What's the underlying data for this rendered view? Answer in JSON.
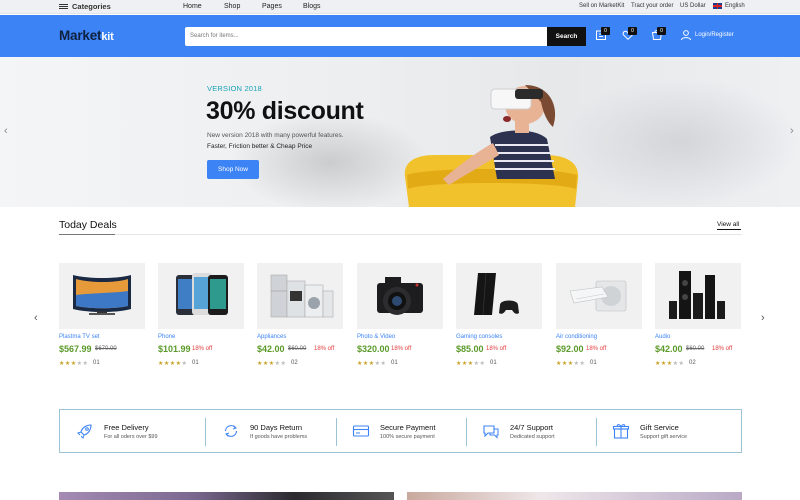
{
  "topbar": {
    "categories": "Categories",
    "nav": [
      "Home",
      "Shop",
      "Pages",
      "Blogs"
    ],
    "sell": "Sell on MarketKit",
    "track": "Tract your order",
    "currency": "US Dollar",
    "language": "English"
  },
  "header": {
    "logo_main": "Market",
    "logo_accent": "kit",
    "search_placeholder": "Search for items...",
    "search_button": "Search",
    "compare_count": "0",
    "wishlist_count": "0",
    "cart_count": "0",
    "login": "Login/Register"
  },
  "hero": {
    "version": "VERSION 2018",
    "headline": "30% discount",
    "line1": "New version 2018 with many powerful features.",
    "line2": "Faster, Friction better & Cheap Price",
    "cta": "Shop Now"
  },
  "deals": {
    "title": "Today Deals",
    "view_all": "View all",
    "products": [
      {
        "name": "Plastma TV set",
        "price": "$567.99",
        "old": "$670.00",
        "off": "",
        "stars": 3,
        "reviews": "01",
        "icon": "tv-icon"
      },
      {
        "name": "Phone",
        "price": "$101.99",
        "old": "",
        "off": "18% off",
        "stars": 4,
        "reviews": "01",
        "icon": "phone-icon"
      },
      {
        "name": "Appliances",
        "price": "$42.00",
        "old": "$60.00",
        "off": "18% off",
        "stars": 3,
        "reviews": "02",
        "icon": "appliances-icon"
      },
      {
        "name": "Photo & Video",
        "price": "$320.00",
        "old": "",
        "off": "18% off",
        "stars": 3,
        "reviews": "01",
        "icon": "camera-icon"
      },
      {
        "name": "Gaming consoles",
        "price": "$85.00",
        "old": "",
        "off": "18% off",
        "stars": 3,
        "reviews": "01",
        "icon": "console-icon"
      },
      {
        "name": "Air conditioning",
        "price": "$92.00",
        "old": "",
        "off": "18% off",
        "stars": 3,
        "reviews": "01",
        "icon": "air-conditioner-icon"
      },
      {
        "name": "Audio",
        "price": "$42.00",
        "old": "$60.00",
        "off": "18% off",
        "stars": 3,
        "reviews": "02",
        "icon": "speakers-icon"
      }
    ]
  },
  "services": [
    {
      "title": "Free Delivery",
      "desc": "For all oders over $99",
      "icon": "rocket-icon"
    },
    {
      "title": "90 Days Return",
      "desc": "If goods have problems",
      "icon": "return-icon"
    },
    {
      "title": "Secure Payment",
      "desc": "100% secure payment",
      "icon": "credit-card-icon"
    },
    {
      "title": "24/7 Support",
      "desc": "Dedicated support",
      "icon": "support-chat-icon"
    },
    {
      "title": "Gift Service",
      "desc": "Support gift service",
      "icon": "gift-icon"
    }
  ],
  "colors": {
    "brand_blue": "#3c83f6",
    "price_green": "#5b9a2a",
    "discount_red": "#e23b3b",
    "teal": "#1aa3b8"
  }
}
